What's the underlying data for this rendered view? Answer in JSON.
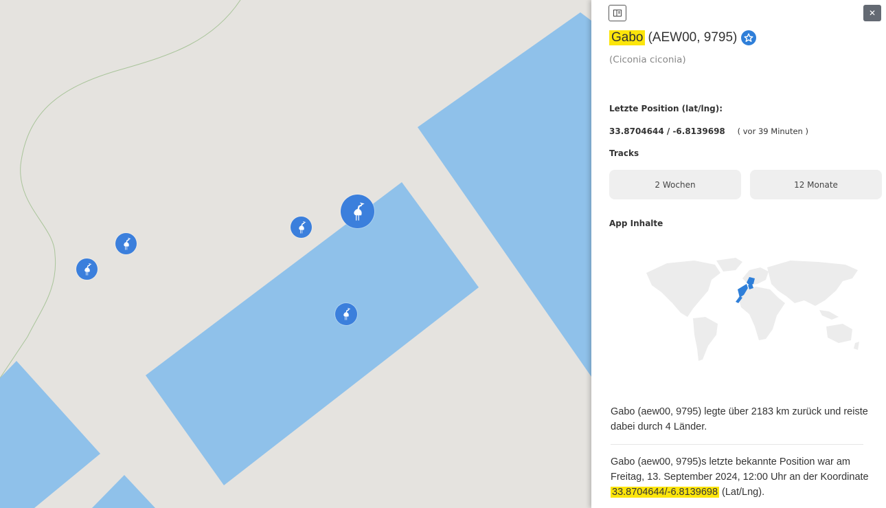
{
  "map": {
    "land_color": "#e5e3df",
    "water_color": "#8fc1ea",
    "marker_color": "#3b7fdc",
    "markers": [
      {
        "name": "stork-marker-1",
        "icon": "stork-icon"
      },
      {
        "name": "stork-marker-2",
        "icon": "stork-icon"
      },
      {
        "name": "stork-marker-3",
        "icon": "stork-icon"
      },
      {
        "name": "stork-marker-selected",
        "icon": "stork-icon"
      },
      {
        "name": "stork-marker-5",
        "icon": "stork-icon"
      }
    ]
  },
  "panel": {
    "sidebar_toggle_icon": "sidebar-toggle-icon",
    "close_label": "✕",
    "bird": {
      "name": "Gabo",
      "ids": "(AEW00, 9795)",
      "species": "(Ciconia ciconia)",
      "favorite_icon": "star-icon",
      "highlight_color": "#fce50b"
    },
    "last_position": {
      "label": "Letzte Position (lat/lng):",
      "value": "33.8704644 / -6.8139698",
      "ago": "( vor 39 Minuten )"
    },
    "tracks": {
      "label": "Tracks",
      "buttons": [
        "2 Wochen",
        "12 Monate"
      ]
    },
    "app_content": {
      "label": "App Inhalte",
      "map_icon": "world-map-with-track",
      "track_color": "#2f7fd9"
    },
    "summary": {
      "distance_text": "Gabo (aew00, 9795) legte über 2183 km zurück und reiste dabei durch 4 Länder.",
      "position_prefix": "Gabo (aew00, 9795)s letzte bekannte Position war am Freitag, 13. September 2024, 12:00 Uhr an der Koordinate ",
      "position_coords": "33.8704644/-6.8139698",
      "position_suffix": " (Lat/Lng)."
    }
  }
}
